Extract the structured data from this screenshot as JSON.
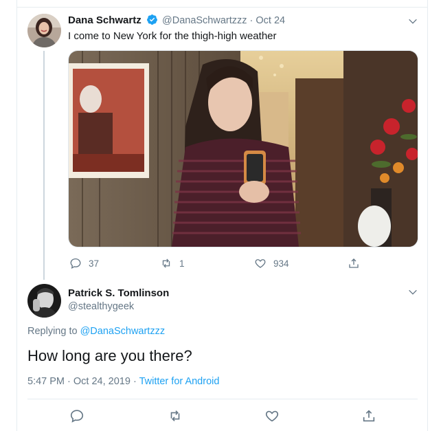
{
  "tweet": {
    "author": {
      "name": "Dana Schwartz",
      "handle": "@DanaSchwartzzz",
      "date": "· Oct 24"
    },
    "text": "I come to New York for the thigh-high weather",
    "actions": {
      "replies": "37",
      "retweets": "1",
      "likes": "934"
    }
  },
  "reply": {
    "author": {
      "name": "Patrick S. Tomlinson",
      "handle": "@stealthygeek"
    },
    "replying_prefix": "Replying to",
    "replying_handle": "@DanaSchwartzzz",
    "text": "How long are you there?",
    "time": "5:47 PM",
    "date": "· Oct 24, 2019 ·",
    "source": "Twitter for Android"
  },
  "colors": {
    "accent": "#1da1f2",
    "muted": "#657786",
    "text": "#14171a"
  }
}
